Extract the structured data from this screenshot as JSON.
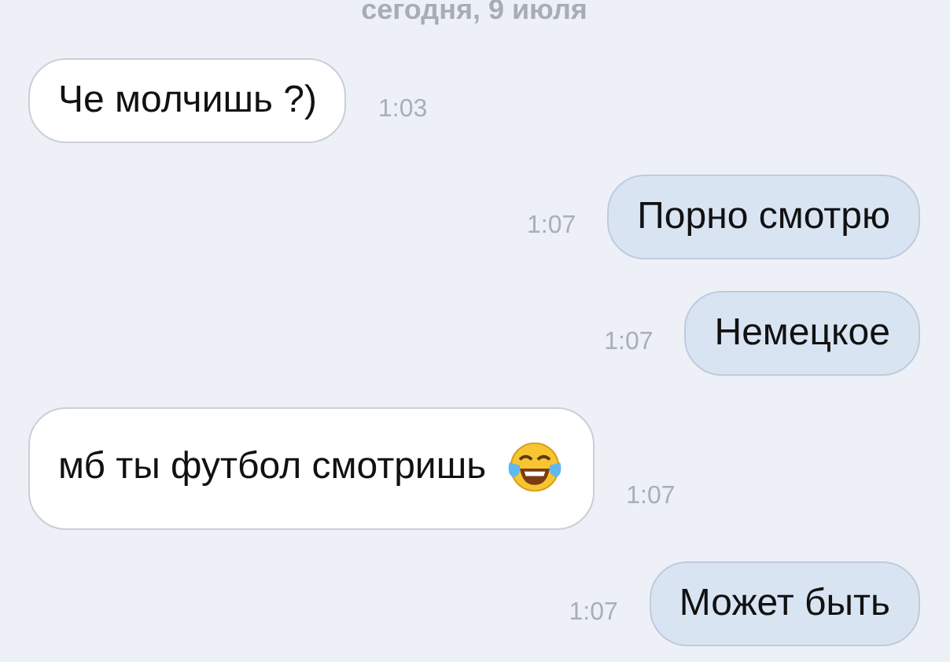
{
  "date_header": "сегодня, 9 июля",
  "messages": [
    {
      "kind": "incoming",
      "text": "Че молчишь ?)",
      "time": "1:03"
    },
    {
      "kind": "outgoing",
      "text": "Порно смотрю",
      "time": "1:07"
    },
    {
      "kind": "outgoing",
      "text": "Немецкое",
      "time": "1:07"
    },
    {
      "kind": "incoming",
      "text": "мб ты футбол смотришь",
      "time": "1:07",
      "emoji": true
    },
    {
      "kind": "outgoing",
      "text": "Может быть",
      "time": "1:07"
    }
  ]
}
